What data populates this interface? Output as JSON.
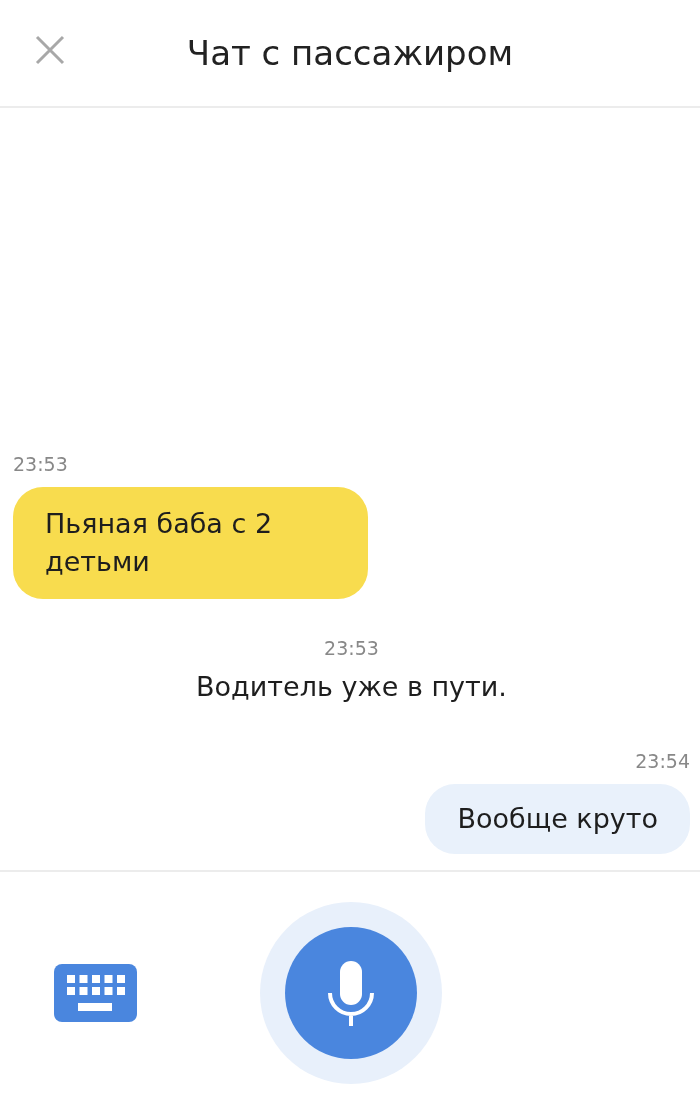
{
  "header": {
    "title": "Чат с пассажиром"
  },
  "messages": [
    {
      "kind": "incoming",
      "time": "23:53",
      "text": "Пьяная баба с 2 детьми"
    },
    {
      "kind": "system",
      "time": "23:53",
      "text": "Водитель уже в пути."
    },
    {
      "kind": "outgoing",
      "time": "23:54",
      "text": "Вообще круто"
    }
  ]
}
